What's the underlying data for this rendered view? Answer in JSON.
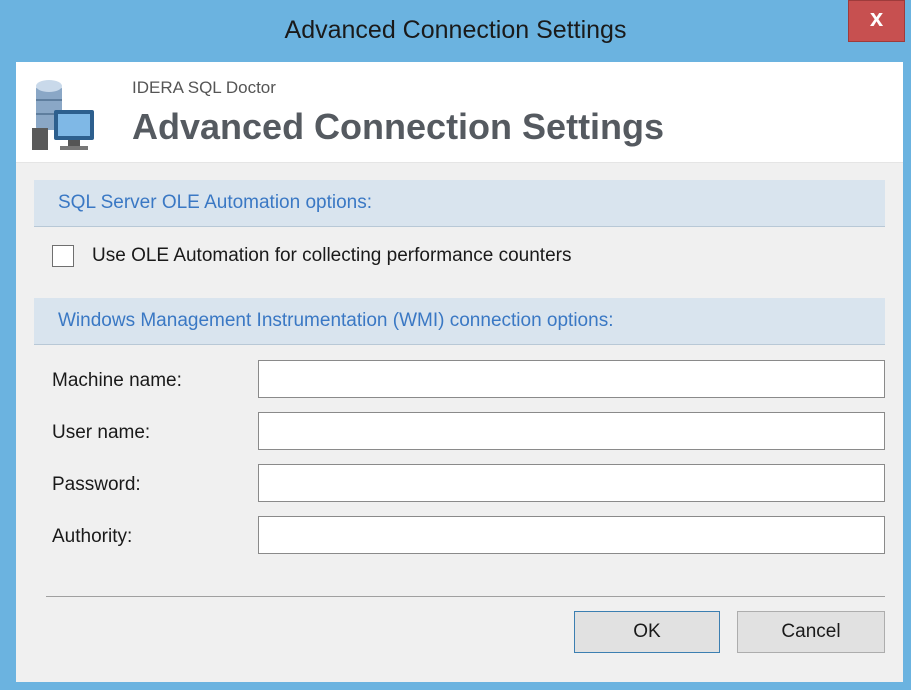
{
  "window": {
    "title": "Advanced Connection Settings",
    "close_label": "x"
  },
  "header": {
    "app_name": "IDERA SQL Doctor",
    "title": "Advanced Connection Settings",
    "icon": "database-computer-icon"
  },
  "ole_section": {
    "heading": "SQL Server OLE Automation options:",
    "checkbox_label": "Use OLE Automation for collecting performance counters",
    "checked": false
  },
  "wmi_section": {
    "heading": "Windows Management Instrumentation (WMI) connection options:",
    "fields": [
      {
        "label": "Machine name:",
        "value": ""
      },
      {
        "label": "User name:",
        "value": ""
      },
      {
        "label": "Password:",
        "value": ""
      },
      {
        "label": "Authority:",
        "value": ""
      }
    ]
  },
  "buttons": {
    "ok": "OK",
    "cancel": "Cancel"
  },
  "colors": {
    "frame": "#6bb3e0",
    "close": "#c75050",
    "section_bg": "#d9e4ee",
    "section_text": "#3a78c4"
  }
}
